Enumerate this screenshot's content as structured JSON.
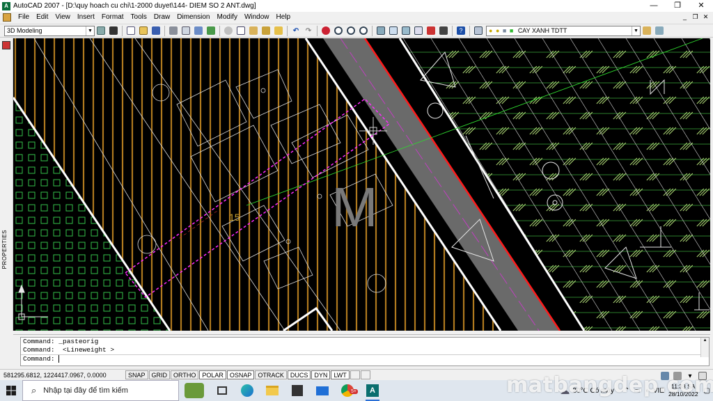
{
  "app": {
    "icon_text": "A",
    "title": "AutoCAD 2007 - [D:\\quy hoach cu chi\\1-2000 duyet\\144- DIEM SO 2 ANT.dwg]"
  },
  "window_controls": {
    "minimize": "—",
    "restore": "❐",
    "close": "✕"
  },
  "menu": [
    "File",
    "Edit",
    "View",
    "Insert",
    "Format",
    "Tools",
    "Draw",
    "Dimension",
    "Modify",
    "Window",
    "Help"
  ],
  "doc_controls": {
    "minimize": "_",
    "restore": "❐",
    "close": "✕"
  },
  "toolbar": {
    "workspace": "3D Modeling",
    "layer": "CAY XANH TDTT"
  },
  "palette": {
    "label": "PROPERTIES"
  },
  "drawing": {
    "zone_label": "M",
    "text_labels": [
      "15"
    ],
    "colors": {
      "background": "#000000",
      "hatch_gold": "#b07a1e",
      "grid_green": "#34c24a",
      "hatch_green": "#b5e07a",
      "road_gray": "#6a6a6a",
      "red_line": "#ff1a1a",
      "selection_magenta": "#ff2bff"
    }
  },
  "command": {
    "history": [
      "Command: _pasteorig",
      "Command:  <Lineweight >"
    ],
    "prompt": "Command:"
  },
  "status": {
    "coordinates": "581295.6812, 1224417.0967, 0.0000",
    "toggles": [
      {
        "label": "SNAP",
        "on": false
      },
      {
        "label": "GRID",
        "on": false
      },
      {
        "label": "ORTHO",
        "on": false
      },
      {
        "label": "POLAR",
        "on": true
      },
      {
        "label": "OSNAP",
        "on": true
      },
      {
        "label": "OTRACK",
        "on": false
      },
      {
        "label": "DUCS",
        "on": true
      },
      {
        "label": "DYN",
        "on": true
      },
      {
        "label": "LWT",
        "on": true
      }
    ]
  },
  "taskbar": {
    "search_placeholder": "Nhập tại đây để tìm kiếm",
    "weather": "30°C  Có mây",
    "lang": "VIE",
    "time": "11:33 SA",
    "date": "28/10/2022",
    "mail_badge": "5+"
  },
  "watermark": "matbangdep.com"
}
